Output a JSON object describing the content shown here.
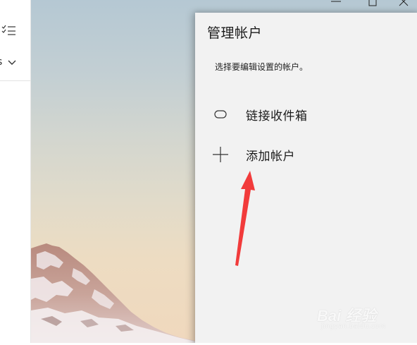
{
  "left_strip": {
    "partial_label": "s"
  },
  "window_controls": {
    "icons": [
      "minimize-icon",
      "maximize-icon",
      "close-icon"
    ]
  },
  "flyout": {
    "title": "管理帐户",
    "subtitle": "选择要编辑设置的帐户。",
    "items": [
      {
        "label": "链接收件箱",
        "icon": "link-icon"
      },
      {
        "label": "添加帐户",
        "icon": "plus-icon"
      }
    ]
  },
  "annotation": {
    "arrow_color": "#f23b3b"
  },
  "watermark": {
    "text": "Bai 经验",
    "sub": "jingyan.baidu.com"
  }
}
